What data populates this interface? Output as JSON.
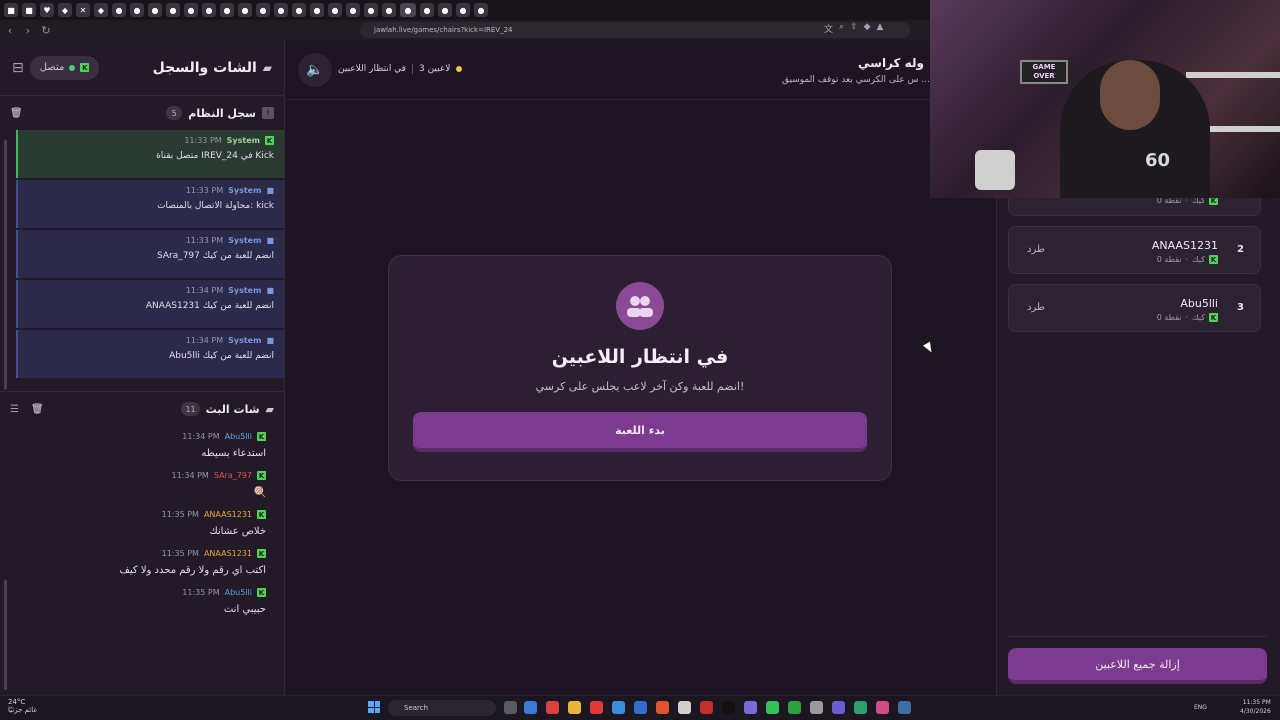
{
  "browser": {
    "url": "jawlah.live/games/chairs?kick=IREV_24"
  },
  "left_panel": {
    "title": "الشات والسجل",
    "connection_label": "متصل",
    "system_log": {
      "title": "سجل النظام",
      "count": "5",
      "entries": [
        {
          "source": "System",
          "time": "11:33 PM",
          "text": "متصل بقناة IREV_24 في Kick",
          "kind": "kick"
        },
        {
          "source": "System",
          "time": "11:33 PM",
          "text": "محاولة الاتصال بالمنصات: kick",
          "kind": "info"
        },
        {
          "source": "System",
          "time": "11:33 PM",
          "text": "SAra_797 انضم للعبة من كيك",
          "kind": "info"
        },
        {
          "source": "System",
          "time": "11:34 PM",
          "text": "ANAAS1231 انضم للعبة من كيك",
          "kind": "info"
        },
        {
          "source": "System",
          "time": "11:34 PM",
          "text": "Abu5lli انضم للعبة من كيك",
          "kind": "info"
        }
      ]
    },
    "stream_chat": {
      "title": "شات البث",
      "count": "11",
      "messages": [
        {
          "user": "Abu5lli",
          "time": "11:34 PM",
          "text": "استدعاء بسيطه",
          "color": "#5aa8e6"
        },
        {
          "user": "SAra_797",
          "time": "11:34 PM",
          "text": "🍭",
          "color": "#e0524f"
        },
        {
          "user": "ANAAS1231",
          "time": "11:35 PM",
          "text": "خلاص عشانك",
          "color": "#e9a53a"
        },
        {
          "user": "ANAAS1231",
          "time": "11:35 PM",
          "text": "اكتب اي رقم ولا رقم محدد ولا كيف",
          "color": "#e9a53a"
        },
        {
          "user": "Abu5lli",
          "time": "11:35 PM",
          "text": "حبيبي انت",
          "color": "#5aa8e6"
        }
      ]
    }
  },
  "center": {
    "players_count": "3 لاعبين",
    "status": "في انتظار اللاعبين",
    "game_title": "وله كراسي",
    "game_subtitle": "س على الكرسي بعد توقف الموسيق ...",
    "card": {
      "title": "في انتظار اللاعبين",
      "subtitle": "انضم للعبة وكن آخر لاعب يجلس على كرسي!",
      "start_button": "بدء اللعبة"
    }
  },
  "right_panel": {
    "players": [
      {
        "rank": "2",
        "name": "ANAAS1231",
        "platform": "كيك",
        "points": "0 نقطة",
        "kick_label": "طرد"
      },
      {
        "rank": "3",
        "name": "Abu5lli",
        "platform": "كيك",
        "points": "0 نقطة",
        "kick_label": "طرد"
      }
    ],
    "partial_player_meta": {
      "platform": "كيك",
      "points": "0 نقطة"
    },
    "remove_all_button": "إزالة جميع اللاعبين"
  },
  "webcam": {
    "sign_line1": "GAME",
    "sign_line2": "OVER",
    "jersey_number": "60"
  },
  "taskbar": {
    "weather_temp": "24°C",
    "weather_desc": "غائم جزئيًا",
    "search_label": "Search",
    "language": "ENG",
    "time": "11:35 PM",
    "date": "4/30/2026"
  },
  "colors": {
    "accent_purple": "#7d3b8f",
    "kick_green": "#53d15b",
    "system_blue": "#7d96de",
    "background": "#1e1522"
  }
}
